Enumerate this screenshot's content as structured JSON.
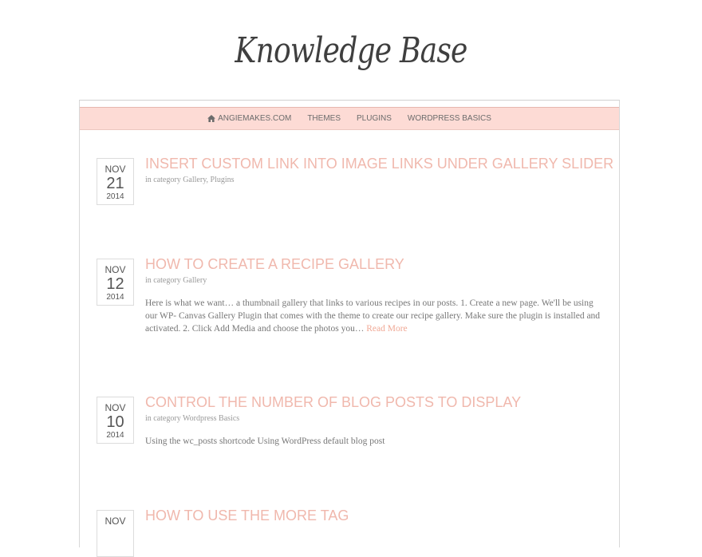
{
  "site": {
    "title": "Knowledge Base"
  },
  "nav": {
    "items": [
      {
        "label": "ANGIEMAKES.COM",
        "icon": "home-icon"
      },
      {
        "label": "THEMES"
      },
      {
        "label": "PLUGINS"
      },
      {
        "label": "WORDPRESS BASICS"
      }
    ]
  },
  "colors": {
    "accent": "#f0b8ad",
    "nav_bg": "#fddbd5"
  },
  "posts": [
    {
      "month": "NOV",
      "day": "21",
      "year": "2014",
      "title": "INSERT CUSTOM LINK INTO IMAGE LINKS UNDER GALLERY SLIDER",
      "cat_prefix": "in category",
      "categories": [
        "Gallery",
        "Plugins"
      ],
      "excerpt": ""
    },
    {
      "month": "NOV",
      "day": "12",
      "year": "2014",
      "title": "HOW TO CREATE A RECIPE GALLERY",
      "cat_prefix": "in category",
      "categories": [
        "Gallery"
      ],
      "excerpt": "Here is what we want… a thumbnail gallery that links to various recipes in our posts. 1. Create a new page. We'll be using our WP- Canvas Gallery Plugin that comes with the theme to create our recipe gallery. Make sure the plugin is installed and activated. 2. Click Add Media and choose the photos you…",
      "read_more": "Read More"
    },
    {
      "month": "NOV",
      "day": "10",
      "year": "2014",
      "title": "CONTROL THE NUMBER OF BLOG POSTS TO DISPLAY",
      "cat_prefix": "in category",
      "categories": [
        "Wordpress Basics"
      ],
      "excerpt": "Using the wc_posts shortcode Using WordPress default blog post"
    },
    {
      "month": "NOV",
      "day": "",
      "year": "",
      "title": "HOW TO USE THE MORE TAG"
    }
  ]
}
